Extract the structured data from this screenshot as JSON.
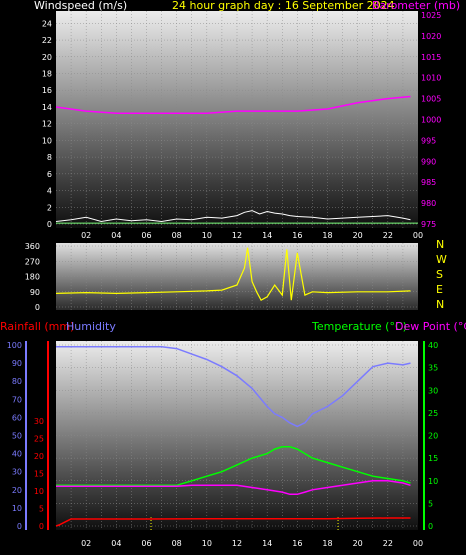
{
  "header": {
    "title": "24 hour graph day : 16 September 2024",
    "windspeed_label": "Windspeed (m/s)",
    "barometer_label": "Barometer (mb)"
  },
  "footer_labels": {
    "rainfall": "Rainfall (mm)",
    "humidity": "Humidity",
    "temperature": "Temperature (°C)",
    "dewpoint": "Dew Point (°C)"
  },
  "colors": {
    "windspeed": "#ffffff",
    "gust": "#7cff7c",
    "barometer": "#ff00ff",
    "direction": "#ffff00",
    "humidity": "#7b7bff",
    "temperature": "#00ff00",
    "dewpoint": "#ff00ff",
    "rainfall": "#ff0000",
    "title": "#ffff00"
  },
  "chart_data": [
    {
      "type": "line",
      "panel": "wind-barometer",
      "x_tick_labels": [
        "02",
        "04",
        "06",
        "08",
        "10",
        "12",
        "14",
        "16",
        "18",
        "20",
        "22",
        "00"
      ],
      "y_left_ticks": [
        "0",
        "2",
        "4",
        "6",
        "8",
        "10",
        "12",
        "14",
        "16",
        "18",
        "20",
        "22",
        "24"
      ],
      "y_left_range": [
        0,
        25
      ],
      "y_right_ticks": [
        "975",
        "980",
        "985",
        "990",
        "995",
        "1000",
        "1005",
        "1010",
        "1015",
        "1020",
        "1025"
      ],
      "y_right_range": [
        975,
        1025
      ],
      "series": [
        {
          "name": "Barometer (mb)",
          "axis": "right",
          "x": [
            0,
            2,
            4,
            6,
            8,
            10,
            12,
            14,
            16,
            18,
            20,
            22,
            23.5
          ],
          "values": [
            1003,
            1002,
            1001.5,
            1001.5,
            1001.5,
            1001.5,
            1002,
            1002,
            1002,
            1002.5,
            1004,
            1005,
            1005.5
          ]
        },
        {
          "name": "Windspeed (m/s)",
          "axis": "left",
          "x": [
            0,
            1,
            2,
            3,
            4,
            5,
            6,
            7,
            8,
            9,
            10,
            11,
            12,
            12.5,
            13,
            13.5,
            14,
            14.5,
            15,
            15.5,
            16,
            17,
            18,
            19,
            20,
            21,
            22,
            23,
            23.5
          ],
          "values": [
            0.3,
            0.5,
            0.8,
            0.3,
            0.6,
            0.4,
            0.5,
            0.3,
            0.6,
            0.5,
            0.8,
            0.7,
            1.0,
            1.4,
            1.6,
            1.2,
            1.5,
            1.3,
            1.2,
            1.0,
            0.9,
            0.8,
            0.6,
            0.7,
            0.8,
            0.9,
            1.0,
            0.7,
            0.5
          ]
        }
      ]
    },
    {
      "type": "line",
      "panel": "wind-direction",
      "y_ticks": [
        "360",
        "270",
        "180",
        "90",
        "0"
      ],
      "y_range": [
        0,
        360
      ],
      "direction_letters": [
        "N",
        "W",
        "S",
        "E",
        "N"
      ],
      "series": [
        {
          "name": "Wind direction",
          "axis": "left",
          "x": [
            0,
            2,
            4,
            6,
            8,
            10,
            11,
            12,
            12.5,
            12.7,
            13,
            13.3,
            13.6,
            14,
            14.5,
            15,
            15.3,
            15.6,
            16,
            16.5,
            17,
            18,
            20,
            22,
            23.5
          ],
          "values": [
            80,
            85,
            80,
            85,
            90,
            95,
            100,
            130,
            230,
            350,
            150,
            90,
            40,
            60,
            130,
            70,
            340,
            40,
            320,
            70,
            90,
            85,
            90,
            90,
            95
          ]
        }
      ]
    },
    {
      "type": "line",
      "panel": "temperature-humidity-rain",
      "x_tick_labels": [
        "02",
        "04",
        "06",
        "08",
        "10",
        "12",
        "14",
        "16",
        "18",
        "20",
        "22",
        "00"
      ],
      "y_left_humidity_ticks": [
        "0",
        "10",
        "20",
        "30",
        "40",
        "50",
        "60",
        "70",
        "80",
        "90",
        "100"
      ],
      "y_left_rain_ticks": [
        "0",
        "5",
        "10",
        "15",
        "20",
        "25",
        "30"
      ],
      "y_right_ticks": [
        "0",
        "5",
        "10",
        "15",
        "20",
        "25",
        "30",
        "35",
        "40"
      ],
      "y_right_range": [
        0,
        40
      ],
      "series": [
        {
          "name": "Humidity",
          "axis": "humidity",
          "x": [
            0,
            2,
            4,
            6,
            7,
            8,
            9,
            10,
            11,
            12,
            13,
            14,
            14.5,
            15,
            15.5,
            16,
            16.5,
            17,
            18,
            19,
            20,
            21,
            22,
            23,
            23.5
          ],
          "values": [
            99,
            99,
            99,
            99,
            99,
            98,
            95,
            92,
            88,
            83,
            76,
            66,
            62,
            60,
            57,
            55,
            57,
            62,
            66,
            72,
            80,
            88,
            90,
            89,
            90
          ]
        },
        {
          "name": "Temperature (°C)",
          "axis": "right",
          "x": [
            0,
            2,
            4,
            6,
            7,
            8,
            9,
            10,
            11,
            12,
            13,
            14,
            14.5,
            15,
            15.5,
            16,
            16.5,
            17,
            18,
            19,
            20,
            21,
            22,
            23,
            23.5
          ],
          "values": [
            9,
            9,
            9,
            9,
            9,
            9,
            10,
            11,
            12,
            13.5,
            15,
            16,
            17,
            17.5,
            17.5,
            17,
            16,
            15,
            14,
            13,
            12,
            11,
            10.5,
            10,
            9.5
          ]
        },
        {
          "name": "Dew Point (°C)",
          "axis": "right",
          "x": [
            0,
            2,
            4,
            6,
            8,
            9,
            10,
            11,
            12,
            13,
            14,
            15,
            15.5,
            16,
            16.5,
            17,
            18,
            19,
            20,
            21,
            22,
            23,
            23.5
          ],
          "values": [
            8.8,
            8.8,
            8.8,
            8.8,
            8.8,
            9,
            9,
            9,
            9,
            8.5,
            8,
            7.5,
            7,
            7,
            7.5,
            8,
            8.5,
            9,
            9.5,
            10,
            10,
            9.5,
            9
          ]
        },
        {
          "name": "Rainfall (mm)",
          "axis": "rain",
          "x": [
            0,
            0.2,
            0.8,
            1,
            6,
            10,
            14,
            18,
            20,
            22,
            23.5
          ],
          "values": [
            0,
            0.3,
            1.6,
            2.0,
            2.0,
            2.1,
            2.1,
            2.1,
            2.2,
            2.3,
            2.3
          ]
        }
      ],
      "markers_x": [
        6.3,
        18.7
      ]
    }
  ]
}
